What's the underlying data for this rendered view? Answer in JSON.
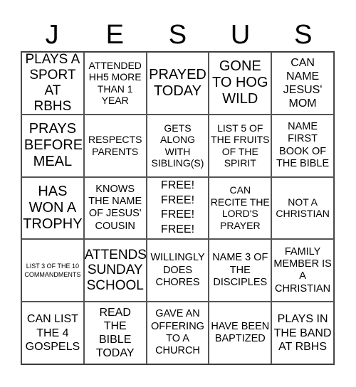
{
  "header": {
    "letters": [
      "J",
      "E",
      "S",
      "U",
      "S"
    ]
  },
  "board": {
    "rows": [
      [
        "PLAYS A SPORT AT RBHS",
        "ATTENDED HH5 MORE THAN 1 YEAR",
        "PRAYED TODAY",
        "GONE TO HOG WILD",
        "CAN NAME JESUS' MOM"
      ],
      [
        "PRAYS BEFORE MEAL",
        "RESPECTS PARENTS",
        "GETS ALONG WITH SIBLING(S)",
        "LIST 5 OF THE FRUITS OF THE SPIRIT",
        "NAME FIRST BOOK OF THE BIBLE"
      ],
      [
        "HAS WON A TROPHY",
        "KNOWS THE NAME OF JESUS' COUSIN",
        "FREE! FREE! FREE! FREE!",
        "CAN RECITE THE LORD'S PRAYER",
        "NOT A CHRISTIAN"
      ],
      [
        "LIST 3 OF THE 10 COMMANDMENTS",
        "ATTENDS SUNDAY SCHOOL",
        "WILLINGLY DOES CHORES",
        "NAME 3 OF THE DISCIPLES",
        "FAMILY MEMBER IS A CHRISTIAN"
      ],
      [
        "CAN LIST THE 4 GOSPELS",
        "READ THE BIBLE TODAY",
        "GAVE AN OFFERING TO A CHURCH",
        "HAVE BEEN BAPTIZED",
        "PLAYS IN THE BAND AT RBHS"
      ]
    ]
  }
}
